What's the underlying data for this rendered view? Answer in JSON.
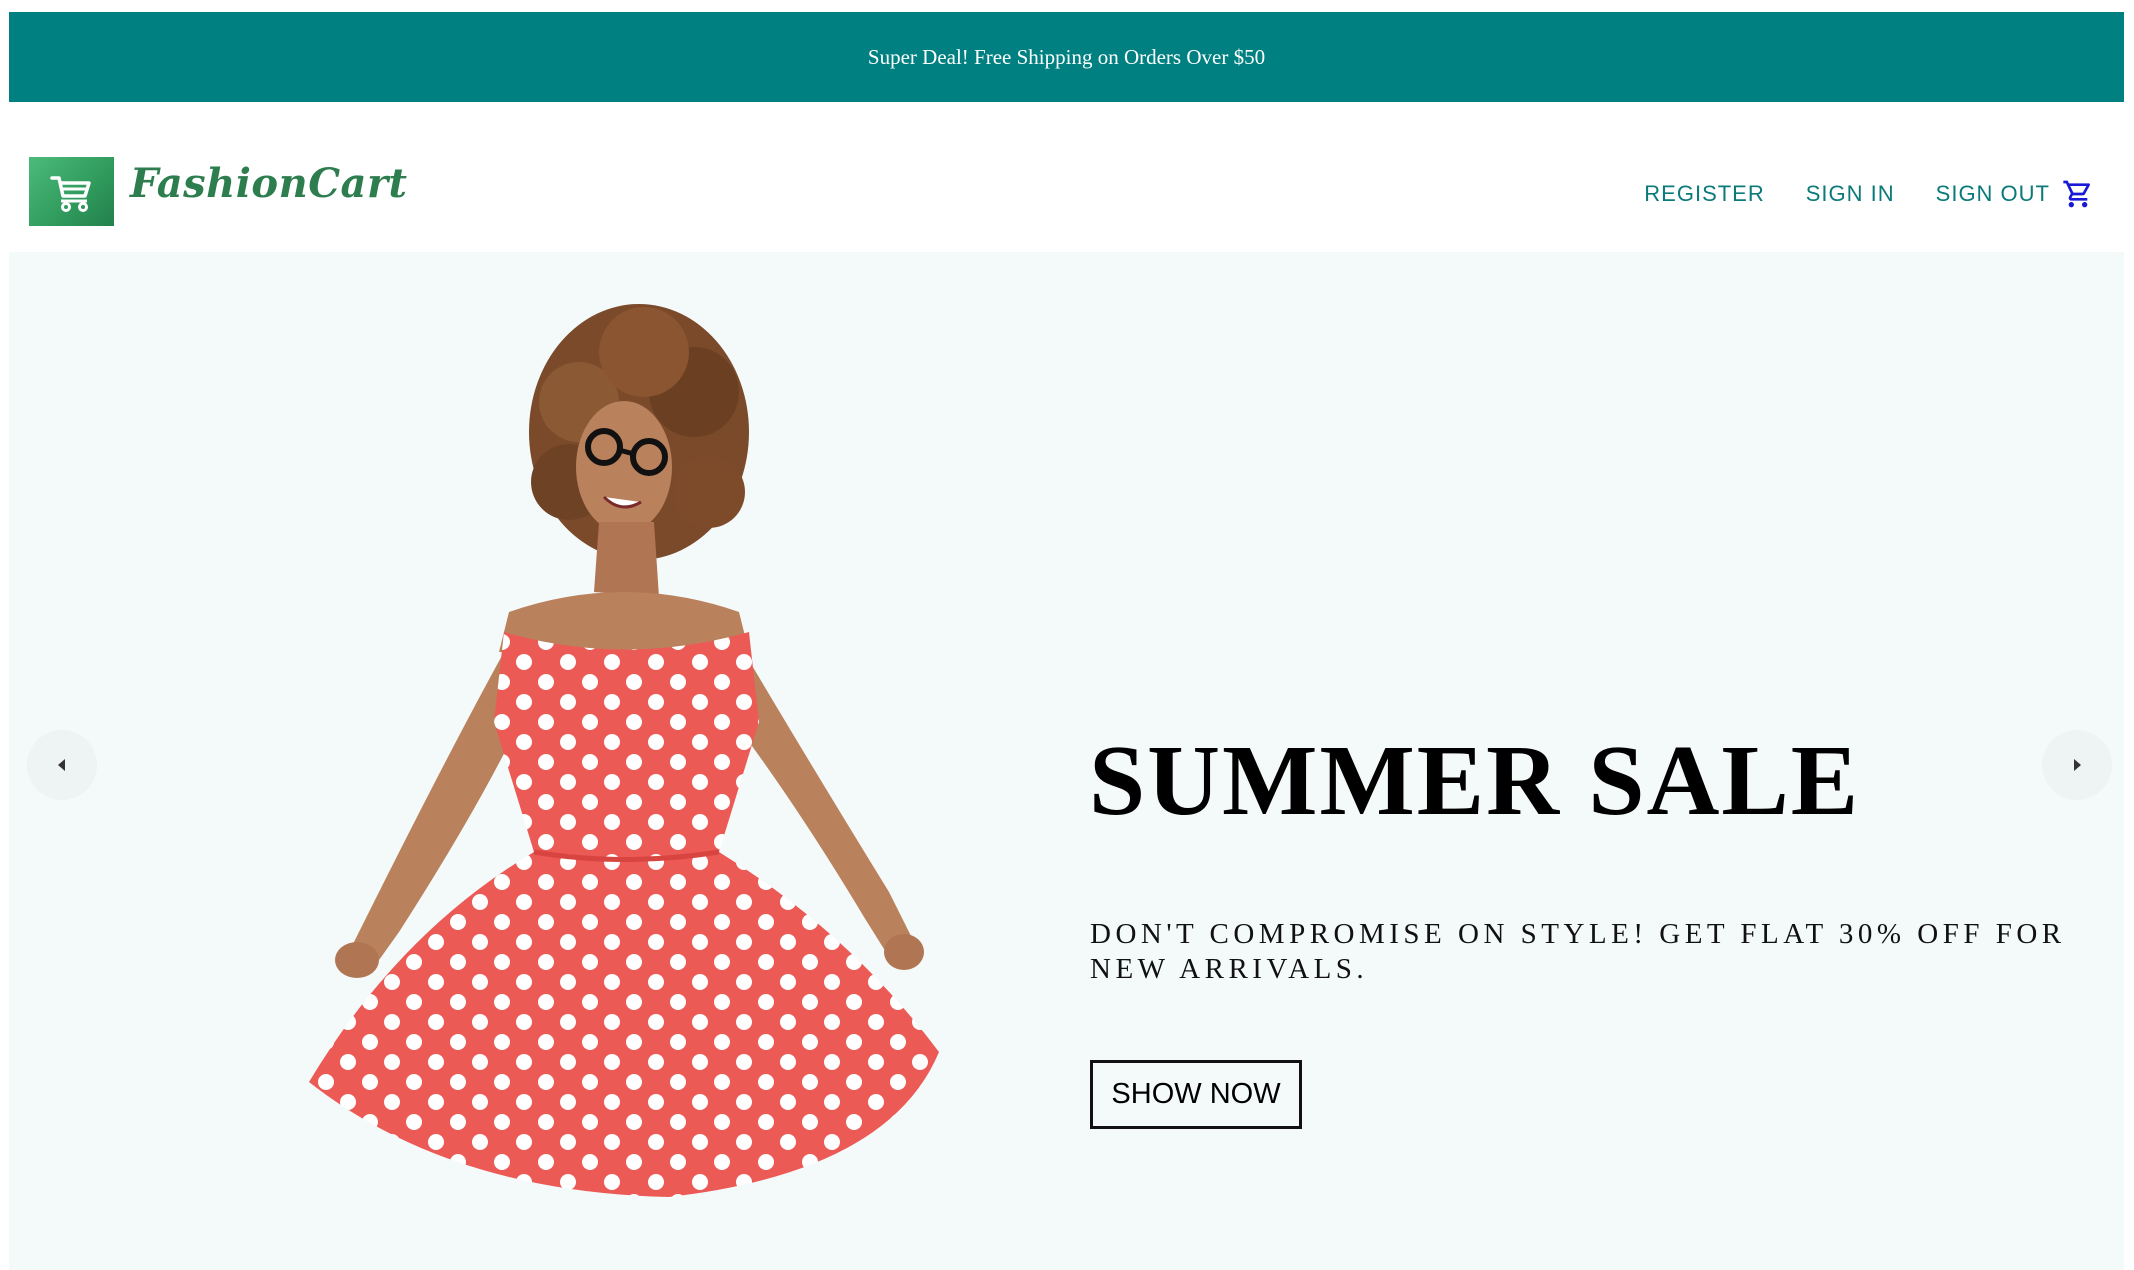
{
  "announcement": {
    "text": "Super Deal! Free Shipping on Orders Over $50"
  },
  "brand": {
    "name": "FashionCart",
    "logo_icon": "cart-icon"
  },
  "nav": {
    "register": "REGISTER",
    "sign_in": "SIGN IN",
    "sign_out": "SIGN OUT",
    "cart_icon": "shopping-cart-icon"
  },
  "slide": {
    "title": "SUMMER SALE",
    "description": "DON'T COMPROMISE ON STYLE! GET FLAT 30% OFF FOR NEW ARRIVALS.",
    "button": "SHOW NOW"
  },
  "colors": {
    "announcement_bg": "#008080",
    "brand_green": "#2e7d4f",
    "nav_link": "#0b7a7a",
    "hero_bg": "#f4f9fa",
    "cart_icon": "#1a1ad6"
  }
}
